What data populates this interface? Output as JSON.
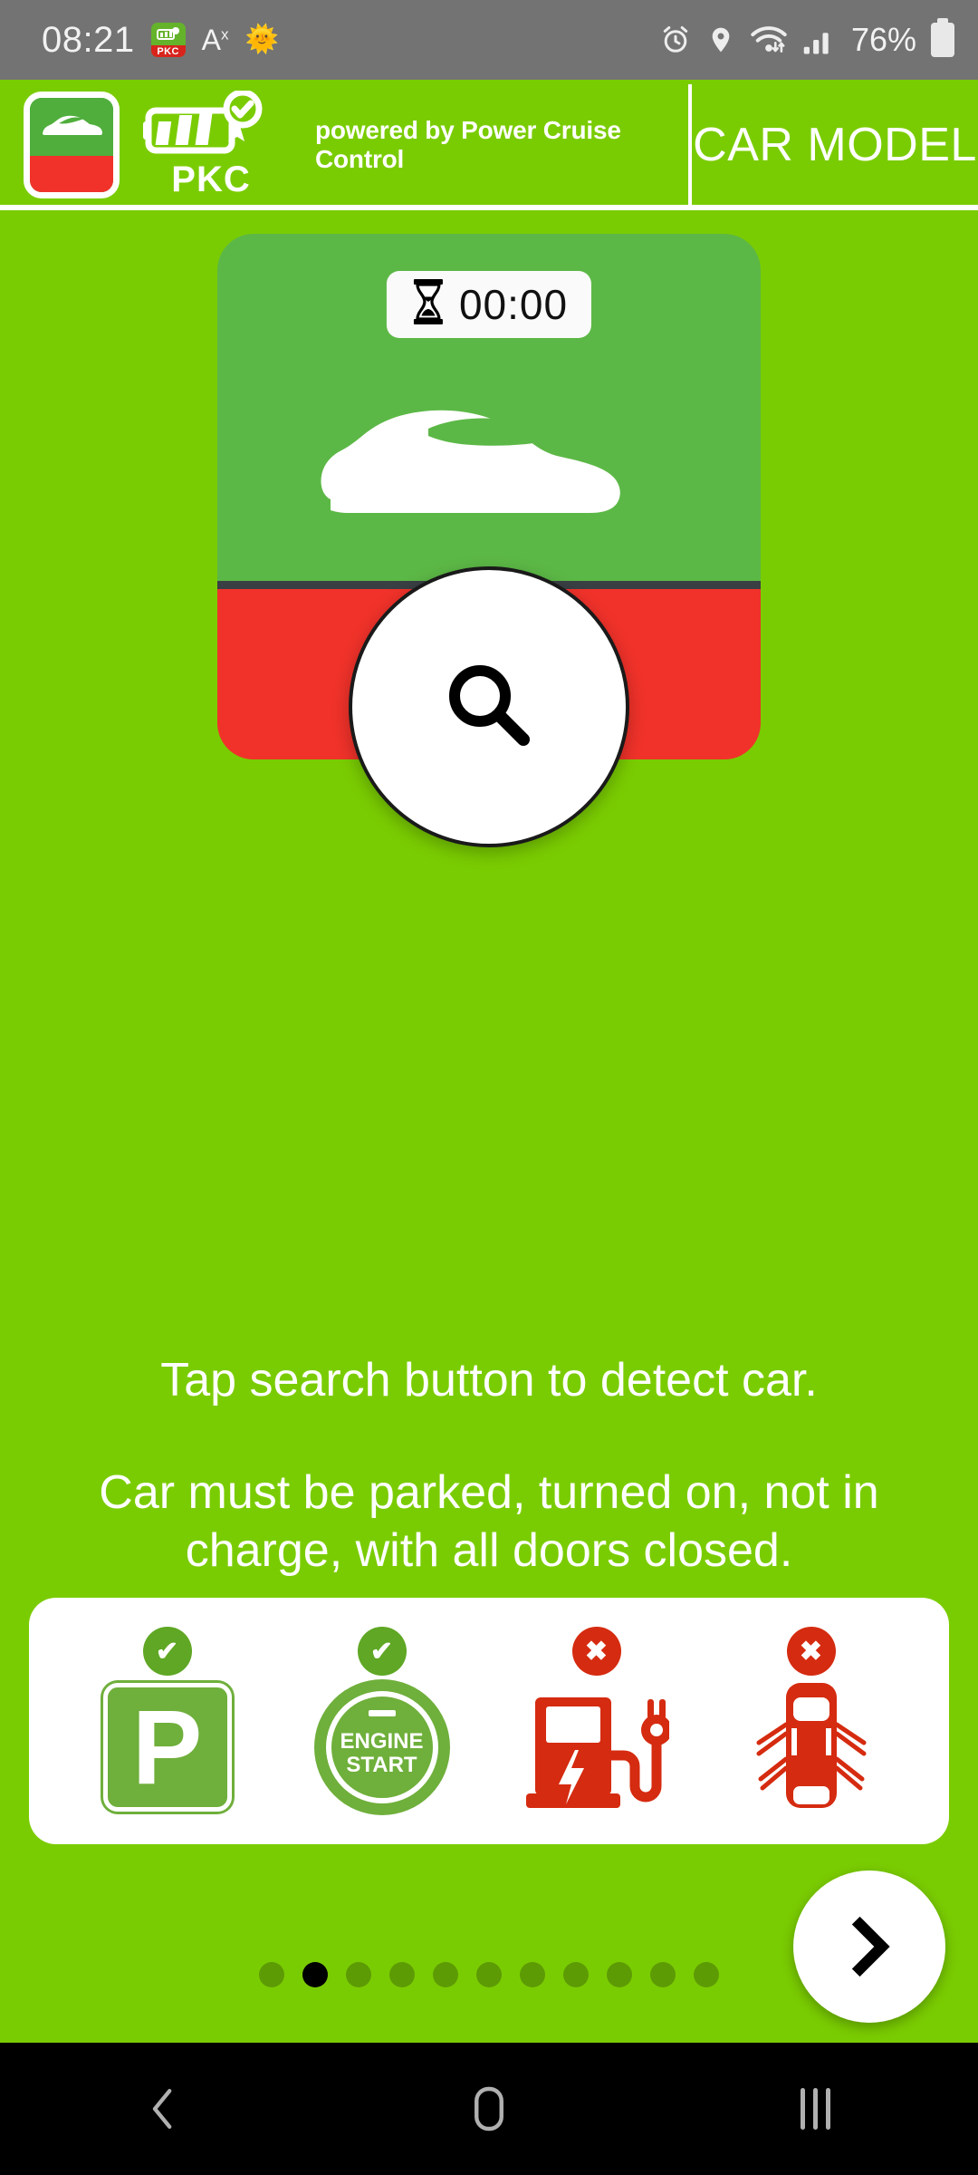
{
  "status_bar": {
    "time": "08:21",
    "app_icon_label": "PKC",
    "text_icon": "A",
    "text_icon_sup": "x",
    "sun_icon": "🌞",
    "icons": [
      "alarm-icon",
      "location-icon",
      "wifi-icon",
      "signal-icon"
    ],
    "battery_percent": "76%"
  },
  "header": {
    "logo_name": "pkc-car-logo",
    "brand": "PKC",
    "tagline": "powered by Power Cruise Control",
    "title": "CAR MODEL"
  },
  "card": {
    "timer": "00:00",
    "timer_icon": "⧗",
    "car_icon_name": "car-side-silhouette",
    "search_button_label": "search-icon"
  },
  "instructions": {
    "line1": "Tap search button to detect car.",
    "line2": "Car must be parked, turned on, not in charge, with all doors closed."
  },
  "requirements": [
    {
      "name": "parked",
      "badge": "✔",
      "badge_type": "ok",
      "glyph": "P"
    },
    {
      "name": "engine-on",
      "badge": "✔",
      "badge_type": "ok",
      "line1": "ENGINE",
      "line2": "START"
    },
    {
      "name": "not-charging",
      "badge": "✖",
      "badge_type": "no",
      "glyph": "charging-station-icon"
    },
    {
      "name": "doors-closed",
      "badge": "✖",
      "badge_type": "no",
      "glyph": "car-doors-open-icon"
    }
  ],
  "pagination": {
    "total": 11,
    "active_index": 1
  },
  "next_button": {
    "label": "next-chevron",
    "glyph": "›"
  },
  "nav_bar": {
    "back": "back-icon",
    "home": "home-icon",
    "recents": "recents-icon"
  },
  "colors": {
    "background": "#7ACC02",
    "card_green": "#5CB846",
    "card_red": "#F0322A",
    "ok_green": "#5FA724",
    "no_red": "#D52B10"
  }
}
